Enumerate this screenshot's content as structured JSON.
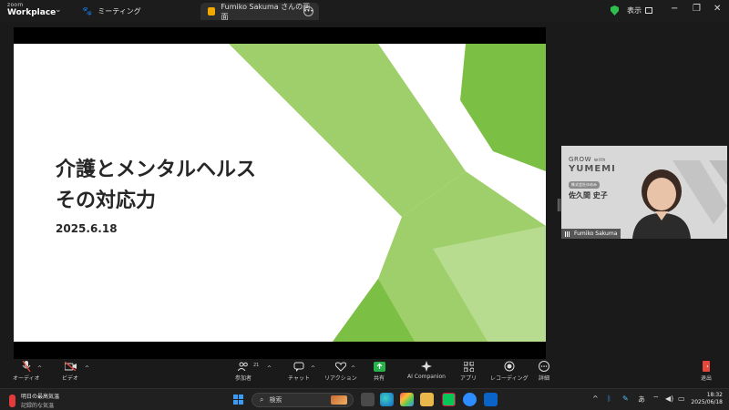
{
  "titlebar": {
    "logo_line1": "zoom",
    "logo_line2": "Workplace",
    "meeting_tab": "ミーティング",
    "share_tab": "Fumiko Sakuma さんの画面",
    "view_label": "表示"
  },
  "slide": {
    "title_line1": "介護とメンタルヘルス",
    "title_line2": "その対応力",
    "date": "2025.6.18",
    "accent_light": "#9fcf6a",
    "accent_dark": "#7cbf45"
  },
  "video": {
    "logo_line1": "GROW",
    "logo_with": "with",
    "logo_line2": "YUMEMI",
    "company": "株式会社ゆめみ",
    "person_name": "佐久間 史子",
    "participant_name": "Fumiko Sakuma"
  },
  "toolbar": {
    "audio": "オーディオ",
    "video": "ビデオ",
    "participants": "参加者",
    "participants_count": "21",
    "chat": "チャット",
    "reactions": "リアクション",
    "share": "共有",
    "ai_companion": "AI Companion",
    "apps": "アプリ",
    "recording": "レコーディング",
    "more": "詳細",
    "leave": "退出"
  },
  "taskbar": {
    "weather_line1": "明日の最高気温",
    "weather_line2": "記録的な気温",
    "search_placeholder": "検索",
    "ime": "あ",
    "time": "18:32",
    "date": "2025/06/18"
  }
}
